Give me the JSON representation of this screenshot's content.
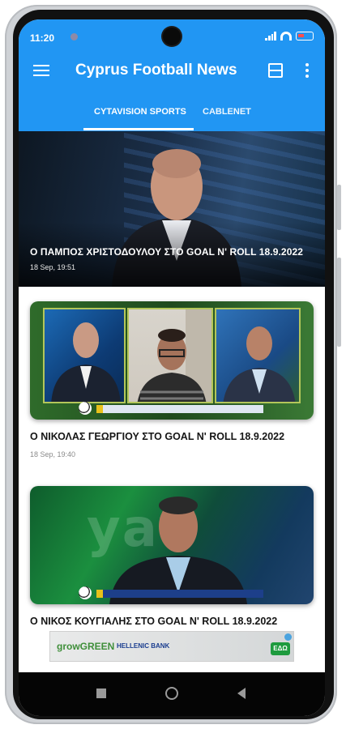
{
  "status_bar": {
    "time": "11:20"
  },
  "app_bar": {
    "title": "Cyprus Football News",
    "icons": [
      "menu-icon",
      "view-toggle-icon",
      "more-vert-icon"
    ]
  },
  "tabs": [
    {
      "label": "CYTAVISION SPORTS",
      "selected": true
    },
    {
      "label": "CABLENET",
      "selected": false
    }
  ],
  "hero": {
    "title": "Ο ΠΑΜΠΟΣ ΧΡΙΣΤΟΔΟΥΛΟΥ ΣΤΟ GOAL N' ROLL 18.9.2022",
    "time": "18 Sep, 19:51"
  },
  "articles": [
    {
      "title": "Ο ΝΙΚΟΛΑΣ ΓΕΩΡΓΙΟΥ ΣΤΟ GOAL N' ROLL 18.9.2022",
      "time": "18 Sep, 19:40"
    },
    {
      "title": "Ο ΝΙΚΟΣ ΚΟΥΓΙΑΛΗΣ ΣΤΟ GOAL N' ROLL 18.9.2022"
    }
  ],
  "thumb2_overlay": "yav",
  "ad": {
    "brand": "growGREEN",
    "bank": "HELLENIC BANK",
    "cta": "ΕΔΩ"
  },
  "colors": {
    "primary": "#2196f3",
    "accent_white": "#ffffff"
  }
}
